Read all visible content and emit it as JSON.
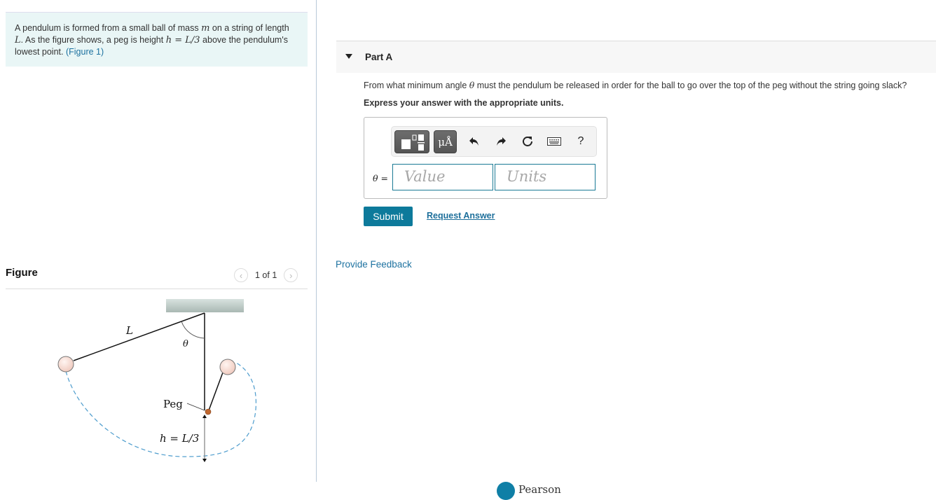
{
  "problem": {
    "text_1": "A pendulum is formed from a small ball of mass ",
    "m": "m",
    "text_2": " on a string of length ",
    "L": "L",
    "text_3": ". As the figure shows, a peg is height ",
    "h": "h",
    "eq": " = ",
    "L3": "L/3",
    "text_4": " above the pendulum's lowest point. ",
    "figure_link": "(Figure 1)"
  },
  "figure_panel": {
    "title": "Figure",
    "pager": "1 of 1",
    "prev_icon": "chevron-left-icon",
    "next_icon": "chevron-right-icon",
    "labels": {
      "L": "L",
      "theta": "θ",
      "peg": "Peg",
      "h": "h = L/3"
    },
    "colors": {
      "ball": "#f7dcd4",
      "peg": "#c0672f",
      "path": "#4d9ccd",
      "ceiling": "#b9c6c2"
    }
  },
  "part": {
    "title": "Part A",
    "question_1": "From what minimum angle ",
    "question_theta": "θ",
    "question_2": " must the pendulum be released in order for the ball to go over the top of the peg without the string going slack?",
    "express": "Express your answer with the appropriate units."
  },
  "toolbar": {
    "templates_icon": "fraction-templates-icon",
    "units_label": "μÅ",
    "undo_icon": "undo-icon",
    "redo_icon": "redo-icon",
    "reset_icon": "reset-icon",
    "keyboard_icon": "keyboard-icon",
    "help_label": "?"
  },
  "answer": {
    "variable": "θ =",
    "value_placeholder": "Value",
    "units_placeholder": "Units",
    "value": "",
    "units": ""
  },
  "actions": {
    "submit": "Submit",
    "request_answer": "Request Answer",
    "provide_feedback": "Provide Feedback"
  },
  "footer": {
    "logo_text": "Pearson"
  },
  "colors": {
    "accent": "#0d7a9b",
    "link": "#1d72a0",
    "problem_bg": "#e9f6f6"
  }
}
